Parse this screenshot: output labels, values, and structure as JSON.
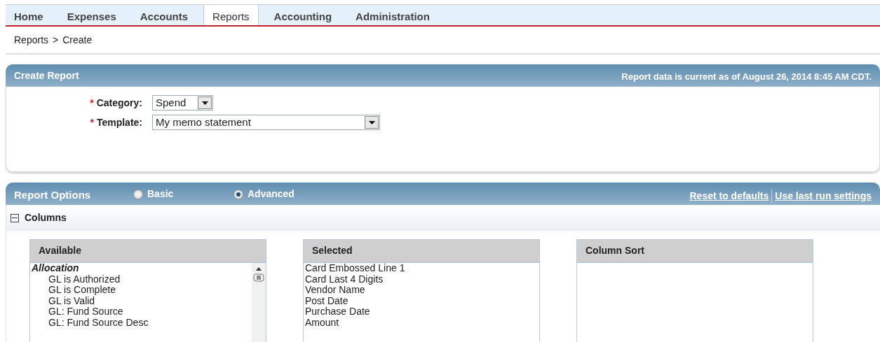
{
  "nav": {
    "tabs": [
      {
        "label": "Home",
        "selected": false
      },
      {
        "label": "Expenses",
        "selected": false
      },
      {
        "label": "Accounts",
        "selected": false
      },
      {
        "label": "Reports",
        "selected": true
      },
      {
        "label": "Accounting",
        "selected": false
      },
      {
        "label": "Administration",
        "selected": false
      }
    ]
  },
  "breadcrumb": {
    "items": [
      "Reports",
      "Create"
    ],
    "separator": ">"
  },
  "create_report": {
    "title": "Create Report",
    "data_note": "Report data is current as of August 26, 2014 8:45 AM CDT.",
    "fields": [
      {
        "label": "Category:",
        "required_mark": "*",
        "value": "Spend"
      },
      {
        "label": "Template:",
        "required_mark": "*",
        "value": "My memo statement"
      }
    ]
  },
  "report_options": {
    "title": "Report Options",
    "modes": [
      {
        "label": "Basic",
        "selected": false
      },
      {
        "label": "Advanced",
        "selected": true
      }
    ],
    "links": [
      "Reset to defaults",
      "Use last run settings"
    ],
    "section": {
      "title": "Columns",
      "expanded": true
    },
    "lists": [
      {
        "heading": "Available",
        "scrollbar": true,
        "items": [
          {
            "label": "Allocation",
            "children": [
              {
                "label": "GL is Authorized"
              },
              {
                "label": "GL is Complete"
              },
              {
                "label": "GL is Valid"
              },
              {
                "label": "GL: Fund Source"
              },
              {
                "label": "GL: Fund Source Desc"
              }
            ]
          }
        ]
      },
      {
        "heading": "Selected",
        "scrollbar": false,
        "items": [
          {
            "label": "Card Embossed Line 1"
          },
          {
            "label": "Card Last 4 Digits"
          },
          {
            "label": "Vendor Name"
          },
          {
            "label": "Post Date"
          },
          {
            "label": "Purchase Date"
          },
          {
            "label": "Amount"
          }
        ]
      },
      {
        "heading": "Column Sort",
        "scrollbar": false
      }
    ]
  }
}
